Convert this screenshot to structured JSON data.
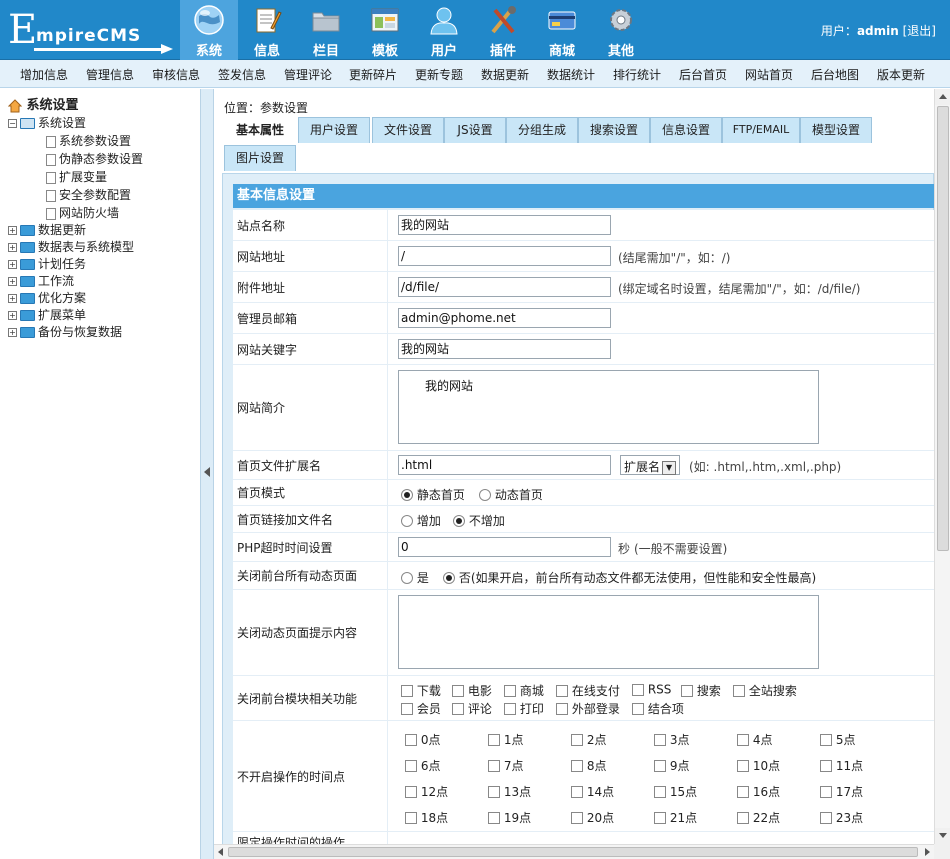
{
  "header": {
    "logo_big": "E",
    "logo_rest": "mpireCMS",
    "nav": [
      {
        "label": "系统",
        "icon": "globe-icon",
        "active": true
      },
      {
        "label": "信息",
        "icon": "notepad-icon",
        "active": false
      },
      {
        "label": "栏目",
        "icon": "folder-icon",
        "active": false
      },
      {
        "label": "模板",
        "icon": "template-window-icon",
        "active": false
      },
      {
        "label": "用户",
        "icon": "user-icon",
        "active": false
      },
      {
        "label": "插件",
        "icon": "tools-icon",
        "active": false
      },
      {
        "label": "商城",
        "icon": "shop-card-icon",
        "active": false
      },
      {
        "label": "其他",
        "icon": "gear-icon",
        "active": false
      }
    ],
    "user_prefix": "用户：",
    "username": "admin",
    "logout": "[退出]"
  },
  "menubar": [
    "增加信息",
    "管理信息",
    "审核信息",
    "签发信息",
    "管理评论",
    "更新碎片",
    "更新专题",
    "数据更新",
    "数据统计",
    "排行统计",
    "后台首页",
    "网站首页",
    "后台地图",
    "版本更新"
  ],
  "tree": {
    "root": "系统设置",
    "group": "系统设置",
    "children": [
      "系统参数设置",
      "伪静态参数设置",
      "扩展变量",
      "安全参数配置",
      "网站防火墙"
    ],
    "others": [
      "数据更新",
      "数据表与系统模型",
      "计划任务",
      "工作流",
      "优化方案",
      "扩展菜单",
      "备份与恢复数据"
    ]
  },
  "location": "位置：参数设置",
  "tabs": [
    "基本属性",
    "用户设置",
    "文件设置",
    "JS设置",
    "分组生成",
    "搜索设置",
    "信息设置",
    "FTP/EMAIL",
    "模型设置",
    "图片设置"
  ],
  "form": {
    "title": "基本信息设置",
    "site_name_label": "站点名称",
    "site_name": "我的网站",
    "site_url_label": "网站地址",
    "site_url": "/",
    "site_url_hint": "(结尾需加\"/\"，如：/)",
    "attach_url_label": "附件地址",
    "attach_url": "/d/file/",
    "attach_url_hint": "(绑定域名时设置，结尾需加\"/\"，如：/d/file/)",
    "admin_email_label": "管理员邮箱",
    "admin_email": "admin@phome.net",
    "keywords_label": "网站关键字",
    "keywords": "我的网站",
    "intro_label": "网站简介",
    "intro": "我的网站",
    "ext_label": "首页文件扩展名",
    "ext": ".html",
    "ext_select": "扩展名",
    "ext_hint": "(如: .html,.htm,.xml,.php)",
    "home_mode_label": "首页模式",
    "home_mode_static": "静态首页",
    "home_mode_dynamic": "动态首页",
    "home_link_label": "首页链接加文件名",
    "home_link_add": "增加",
    "home_link_noadd": "不增加",
    "php_timeout_label": "PHP超时时间设置",
    "php_timeout": "0",
    "php_timeout_unit": "秒",
    "php_timeout_hint": "(一般不需要设置)",
    "close_dynamic_label": "关闭前台所有动态页面",
    "close_dynamic_yes": "是",
    "close_dynamic_no": "否",
    "close_dynamic_hint": "(如果开启，前台所有动态文件都无法使用，但性能和安全性最高)",
    "close_tip_label": "关闭动态页面提示内容",
    "close_modules_label": "关闭前台模块相关功能",
    "modules_row1": [
      "下载",
      "电影",
      "商城",
      "在线支付",
      "RSS",
      "搜索",
      "全站搜索"
    ],
    "modules_row2": [
      "会员",
      "评论",
      "打印",
      "外部登录",
      "结合项"
    ],
    "hours_label": "不开启操作的时间点",
    "hours": [
      "0点",
      "1点",
      "2点",
      "3点",
      "4点",
      "5点",
      "6点",
      "7点",
      "8点",
      "9点",
      "10点",
      "11点",
      "12点",
      "13点",
      "14点",
      "15点",
      "16点",
      "17点",
      "18点",
      "19点",
      "20点",
      "21点",
      "22点",
      "23点"
    ],
    "next_label": "限定操作时间的操作"
  }
}
